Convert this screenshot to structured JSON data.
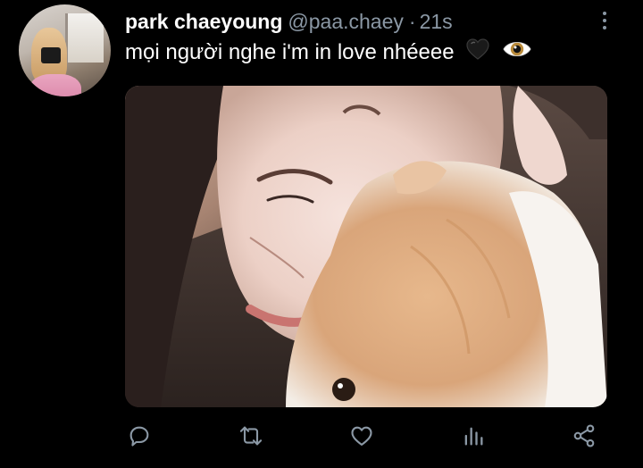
{
  "tweet": {
    "author_name": "park chaeyoung",
    "handle": "@paa.chaey",
    "separator": "·",
    "time": "21s",
    "text": "mọi người nghe i'm in love nhéeee",
    "emojis": [
      "black-heart",
      "eye"
    ]
  },
  "actions": {
    "icons": [
      "reply-icon",
      "retweet-icon",
      "like-icon",
      "analytics-icon",
      "share-icon"
    ]
  },
  "colors": {
    "background": "#000000",
    "primary_text": "#ffffff",
    "secondary_text": "#8b98a5"
  }
}
